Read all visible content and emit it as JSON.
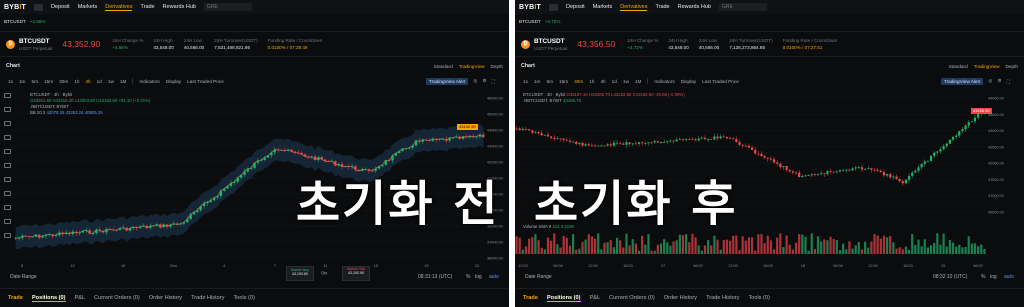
{
  "left": {
    "nav": {
      "logo": "BYBIT",
      "items": [
        "Deposit",
        "Markets",
        "Derivatives",
        "Trade",
        "Rewards Hub"
      ],
      "search_placeholder": "GRE"
    },
    "pair_strip": {
      "symbol": "BTCUSDT",
      "change": "+4.66%"
    },
    "ticker": {
      "symbol": "BTCUSDT",
      "subtitle": "USDT Perpetual",
      "price": "43,352.90",
      "stats": [
        {
          "k": "24H Change %",
          "v": "+4.66%",
          "cls": "g"
        },
        {
          "k": "24H High",
          "v": "43,548.00",
          "cls": ""
        },
        {
          "k": "24H Low",
          "v": "40,566.00",
          "cls": ""
        },
        {
          "k": "24H Turnover(USDT)",
          "v": "7,531,488,821.95",
          "cls": ""
        },
        {
          "k": "Funding Rate / Countdown",
          "v": "0.0100% / 07:28:49",
          "cls": "o"
        }
      ]
    },
    "chart_header": {
      "title": "Chart",
      "views": [
        "Standard",
        "TradingView",
        "Depth"
      ]
    },
    "toolbar": {
      "intervals": [
        "1s",
        "1m",
        "5m",
        "15m",
        "30m",
        "1h",
        "4h",
        "1d",
        "1w",
        "1M"
      ],
      "active": "4h",
      "indicators": "Indicators",
      "display": "Display",
      "last_price": "Last Traded Price",
      "tv_alert": "TradingView Alert"
    },
    "legend": {
      "line1": "BTCUSDT · 4h · Bybit",
      "ohlc": "O43261.80 H43310.40 L43303.80 C43192.90 +91.10 (+0.21%)",
      "line2": ".NBTCUSDT, BYBIT",
      "bb": "BB 20 2",
      "bbv": "42079.25  43353.24  40805.25"
    },
    "price_tag": "43192.90",
    "x_axis": [
      "8",
      "12",
      "16",
      "Dec",
      "4",
      "7",
      "11",
      "15",
      "19",
      "22"
    ],
    "y_axis": [
      "46000.00",
      "45000.00",
      "44000.00",
      "43000.00",
      "42000.00",
      "41000.00",
      "40000.00",
      "39000.00",
      "38000.00",
      "37000.00",
      "36000.00"
    ],
    "date_range": "Date Range",
    "clock": "08:31:13 (UTC)",
    "market_buy": {
      "label": "Market Buy",
      "price": "43,193.80"
    },
    "qty": "Qty",
    "market_sell": {
      "label": "Market Sell",
      "price": "43,192.90"
    },
    "scale_opts": [
      "%",
      "log",
      "auto"
    ],
    "tabs": [
      "Trade",
      "Positions (0)",
      "P&L",
      "Current Orders (0)",
      "Order History",
      "Trade History",
      "Tools (0)"
    ],
    "caption": "초기화 전"
  },
  "right": {
    "nav": {
      "logo": "BYBIT",
      "items": [
        "Deposit",
        "Markets",
        "Derivatives",
        "Trade",
        "Rewards Hub"
      ],
      "search_placeholder": "GRE"
    },
    "pair_strip": {
      "symbol": "BTCUSDT",
      "change": "+4.72%"
    },
    "ticker": {
      "symbol": "BTCUSDT",
      "subtitle": "USDT Perpetual",
      "price": "43,356.50",
      "stats": [
        {
          "k": "24H Change %",
          "v": "+4.72%",
          "cls": "g"
        },
        {
          "k": "24H High",
          "v": "43,548.00",
          "cls": ""
        },
        {
          "k": "24H Low",
          "v": "40,566.00",
          "cls": ""
        },
        {
          "k": "24H Turnover(USDT)",
          "v": "7,126,273,864.85",
          "cls": ""
        },
        {
          "k": "Funding Rate / Countdown",
          "v": "0.0100% / 07:27:51",
          "cls": "o"
        }
      ]
    },
    "chart_header": {
      "title": "Chart",
      "views": [
        "Standard",
        "TradingView",
        "Depth"
      ]
    },
    "toolbar": {
      "intervals": [
        "1s",
        "1m",
        "5m",
        "15m",
        "30m",
        "1h",
        "4h",
        "1d",
        "1w",
        "1M"
      ],
      "active": "30m",
      "indicators": "Indicators",
      "display": "Display",
      "last_price": "Last Traded Price",
      "tv_alert": "TradingView Alert"
    },
    "legend": {
      "line1": "BTCUSDT · 30 · Bybit",
      "ohlc": "O43197.10 H43205.70 L43152.90 C43156.50 -40.60 (-0.09%)",
      "line2": ".NBTCUSDT, BYBIT",
      "lv": "43156.70"
    },
    "price_tag": "43156.50",
    "volume_label": "Volume SMA 9",
    "volume_vals": "214  3.218K",
    "x_axis": [
      "12:00",
      "06:00",
      "12:00",
      "18:00",
      "17",
      "06:00",
      "12:00",
      "18:00",
      "18",
      "06:00",
      "12:00",
      "18:00",
      "19",
      "06:00"
    ],
    "y_axis": [
      "44000.00",
      "43500.00",
      "43000.00",
      "42500.00",
      "42000.00",
      "41500.00",
      "41000.00",
      "40500.00"
    ],
    "date_range": "Date Range",
    "clock": "08:32:10 (UTC)",
    "scale_opts": [
      "%",
      "log",
      "auto"
    ],
    "tabs": [
      "Trade",
      "Positions (0)",
      "P&L",
      "Current Orders (0)",
      "Order History",
      "Trade History",
      "Tools (0)"
    ],
    "caption": "초기화 후"
  },
  "colors": {
    "up": "#20b26c",
    "down": "#ef454a",
    "accent": "#f7a600",
    "bg": "#0b0c0e",
    "bb_fill": "#1d3b55"
  }
}
